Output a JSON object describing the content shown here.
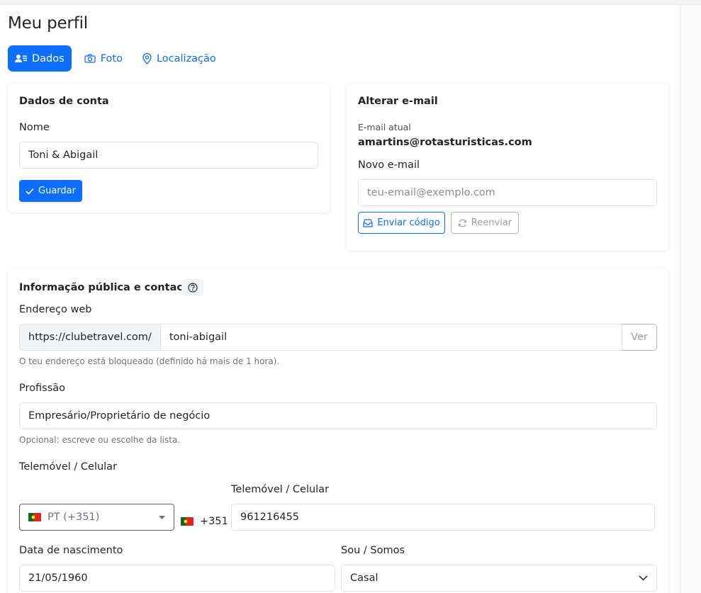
{
  "page": {
    "title": "Meu perfil"
  },
  "tabs": [
    {
      "label": "Dados",
      "icon": "user-card-icon",
      "active": true
    },
    {
      "label": "Foto",
      "icon": "camera-icon",
      "active": false
    },
    {
      "label": "Localização",
      "icon": "map-pin-icon",
      "active": false
    }
  ],
  "account": {
    "title": "Dados de conta",
    "name_label": "Nome",
    "name_value": "Toni & Abigail",
    "save_label": "Guardar"
  },
  "email": {
    "title": "Alterar e-mail",
    "current_label": "E-mail atual",
    "current_value": "amartins@rotasturisticas.com",
    "new_label": "Novo e-mail",
    "new_placeholder": "teu-email@exemplo.com",
    "send_label": "Enviar código",
    "resend_label": "Reenviar"
  },
  "public": {
    "title": "Informação pública e contacto",
    "web_label": "Endereço web",
    "web_prefix": "https://clubetravel.com/",
    "web_slug": "toni-abigail",
    "web_view_label": "Ver",
    "web_help": "O teu endereço está bloqueado (definido há mais de 1 hora).",
    "profession_label": "Profissão",
    "profession_value": "Empresário/Proprietário de negócio",
    "profession_help": "Opcional: escreve ou escolhe da lista.",
    "phone_section_label": "Telemóvel / Celular",
    "country_value": "PT (+351)",
    "dial_code": "+351",
    "phone_label": "Telemóvel / Celular",
    "phone_value": "961216455",
    "birth_label": "Data de nascimento",
    "birth_value": "21/05/1960",
    "status_label": "Sou / Somos",
    "status_value": "Casal"
  },
  "colors": {
    "primary": "#0d6efd",
    "flag_green": "#046a38",
    "flag_red": "#da291c"
  }
}
